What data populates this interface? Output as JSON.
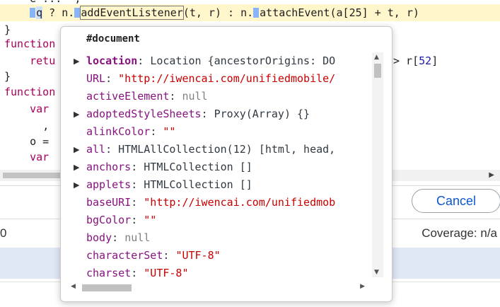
{
  "editor": {
    "line1": {
      "pre": "    ",
      "q": "q",
      "mid1": " ? ",
      "n1": "n.",
      "method1": "addEventListener",
      "args1": "(t, r) : ",
      "n2": "n.",
      "method2": "attachEvent",
      "args2": "(a[25] + t, r)"
    },
    "line2": "}",
    "line3": "function",
    "line4_kw": "retu",
    "line4_tail_pre": "> r[",
    "line4_tail_num": "52",
    "line4_tail_post": "]",
    "line5": "}",
    "line6": "function",
    "line7": "var",
    "line8": ",",
    "line9": "o =",
    "line10": "var"
  },
  "popover": {
    "title": "#document",
    "properties": [
      {
        "name": "location",
        "value": "Location {ancestorOrigins: DO",
        "kind": "obj",
        "expandable": true,
        "bold": true
      },
      {
        "name": "URL",
        "value": "\"http://iwencai.com/unifiedmobile/",
        "kind": "str",
        "expandable": false
      },
      {
        "name": "activeElement",
        "value": "null",
        "kind": "null",
        "expandable": false
      },
      {
        "name": "adoptedStyleSheets",
        "value": "Proxy(Array) {}",
        "kind": "obj",
        "expandable": true
      },
      {
        "name": "alinkColor",
        "value": "\"\"",
        "kind": "str",
        "expandable": false
      },
      {
        "name": "all",
        "value": "HTMLAllCollection(12) [html, head,",
        "kind": "obj",
        "expandable": true
      },
      {
        "name": "anchors",
        "value": "HTMLCollection []",
        "kind": "obj",
        "expandable": true
      },
      {
        "name": "applets",
        "value": "HTMLCollection []",
        "kind": "obj",
        "expandable": true
      },
      {
        "name": "baseURI",
        "value": "\"http://iwencai.com/unifiedmob",
        "kind": "str",
        "expandable": false
      },
      {
        "name": "bgColor",
        "value": "\"\"",
        "kind": "str",
        "expandable": false
      },
      {
        "name": "body",
        "value": "null",
        "kind": "null",
        "expandable": false
      },
      {
        "name": "characterSet",
        "value": "\"UTF-8\"",
        "kind": "str",
        "expandable": false
      },
      {
        "name": "charset",
        "value": "\"UTF-8\"",
        "kind": "str",
        "expandable": false
      }
    ]
  },
  "footer": {
    "cancel_label": "Cancel",
    "status_left": "0",
    "coverage": "Coverage: n/a"
  },
  "icons": {
    "expand": "triangle-right-icon",
    "scroll_up": "scroll-up-arrow-icon",
    "scroll_down": "scroll-down-arrow-icon",
    "scroll_left": "scroll-left-arrow-icon",
    "scroll_right": "scroll-right-arrow-icon"
  },
  "colors": {
    "property_name": "#881280",
    "string_value": "#c80000",
    "null_value": "#808080",
    "highlight_line": "#fff6cc",
    "cancel_text": "#0b57d0"
  }
}
